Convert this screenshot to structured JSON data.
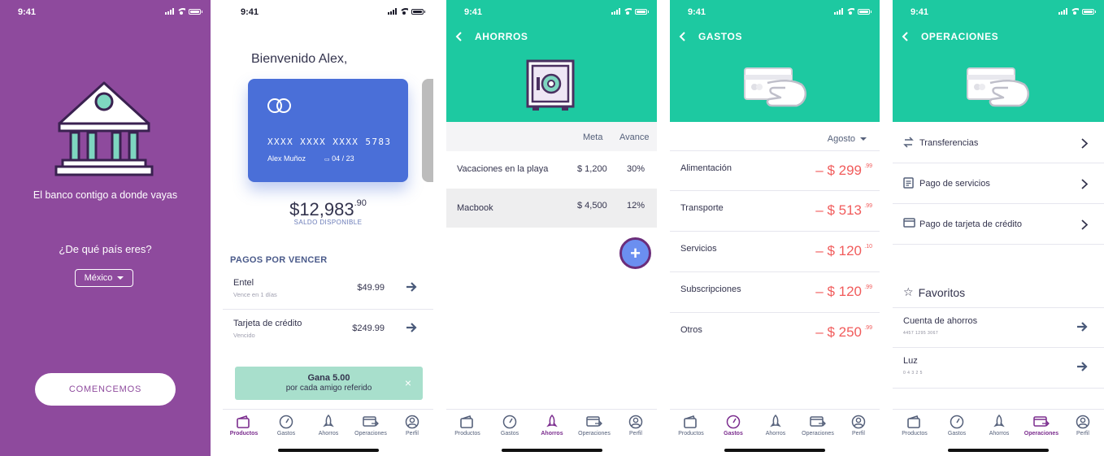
{
  "status": {
    "time": "9:41"
  },
  "colors": {
    "purple": "#8e4a9d",
    "teal": "#1dc9a1",
    "card_blue": "#4a6fd8",
    "negative_red": "#f15b5b",
    "active_tab": "#7b2d8e"
  },
  "welcome_screen": {
    "tagline": "El banco contigo a donde vayas",
    "question": "¿De qué país eres?",
    "country": "México",
    "start_button": "COMENCEMOS",
    "icons": [
      "bank-icon"
    ]
  },
  "home_screen": {
    "greeting": "Bienvenido Alex,",
    "card": {
      "number": "XXXX  XXXX  XXXX  5783",
      "holder": "Alex Muñoz",
      "expiry": "04 / 23"
    },
    "balance": {
      "main": "$12,983",
      "cents": ".90",
      "label": "SALDO DISPONIBLE"
    },
    "payments_title": "PAGOS POR VENCER",
    "payments": [
      {
        "name": "Entel",
        "sub": "Vence en 1 días",
        "amount": "$49.99"
      },
      {
        "name": "Tarjeta de crédito",
        "sub": "Vencido",
        "amount": "$249.99"
      }
    ],
    "promo": {
      "title": "Gana 5.00",
      "text": "por cada amigo referido",
      "close": "×"
    }
  },
  "savings_screen": {
    "title": "AHORROS",
    "columns": {
      "goal": "Meta",
      "progress": "Avance"
    },
    "rows": [
      {
        "name": "Vacaciones en la playa",
        "goal": "$ 1,200",
        "progress": "30%"
      },
      {
        "name": "Macbook",
        "goal": "$ 4,500",
        "progress": "12%"
      }
    ],
    "add_button": "+"
  },
  "expenses_screen": {
    "title": "GASTOS",
    "month": "Agosto",
    "rows": [
      {
        "label": "Alimentación",
        "value": "– $ 299",
        "cents": ".99"
      },
      {
        "label": "Transporte",
        "value": "– $ 513",
        "cents": ".99"
      },
      {
        "label": "Servicios",
        "value": "– $ 120",
        "cents": ".10"
      },
      {
        "label": "Subscripciones",
        "value": "– $ 120",
        "cents": ".99"
      },
      {
        "label": "Otros",
        "value": "– $ 250",
        "cents": ".99"
      }
    ]
  },
  "operations_screen": {
    "title": "OPERACIONES",
    "options": [
      {
        "label": "Transferencias",
        "icon": "transfer-icon"
      },
      {
        "label": "Pago de servicios",
        "icon": "document-icon"
      },
      {
        "label": "Pago de tarjeta de crédito",
        "icon": "card-icon"
      }
    ],
    "favorites_title": "Favoritos",
    "favorites": [
      {
        "label": "Cuenta de ahorros",
        "sub": "4457 1295 3067"
      },
      {
        "label": "Luz",
        "sub": "0 4 3 2 5"
      }
    ]
  },
  "tabs": [
    "Productos",
    "Gastos",
    "Ahorros",
    "Operaciones",
    "Perfil"
  ]
}
